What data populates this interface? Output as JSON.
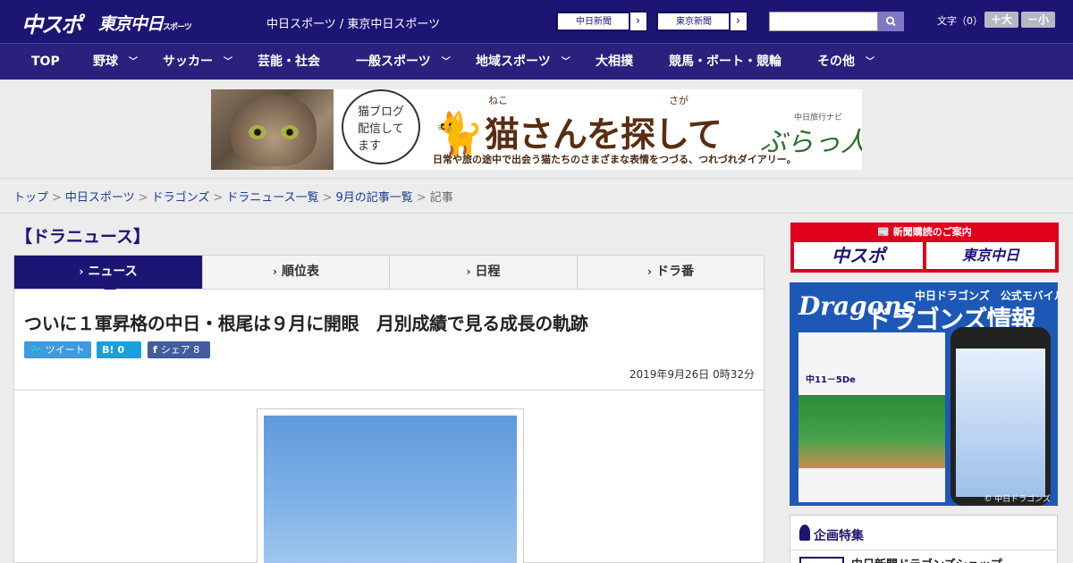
{
  "header": {
    "logo_chunichi": "中スポ",
    "logo_tokyo": "東京中日",
    "logo_tokyo_small": "スポーツ",
    "site_links": "中日スポーツ / 東京中日スポーツ",
    "ext_links": [
      "中日新聞",
      "東京新聞"
    ],
    "search_placeholder": "",
    "font_size_label": "文字（0）",
    "font_larger": "＋大",
    "font_smaller": "－小"
  },
  "nav": {
    "items": [
      {
        "label": "TOP",
        "has_menu": false
      },
      {
        "label": "野球",
        "has_menu": true
      },
      {
        "label": "サッカー",
        "has_menu": true
      },
      {
        "label": "芸能・社会",
        "has_menu": false
      },
      {
        "label": "一般スポーツ",
        "has_menu": true
      },
      {
        "label": "地域スポーツ",
        "has_menu": true
      },
      {
        "label": "大相撲",
        "has_menu": false
      },
      {
        "label": "競馬・ボート・競輪",
        "has_menu": false
      },
      {
        "label": "その他",
        "has_menu": true
      }
    ]
  },
  "banner": {
    "bubble_text": "猫ブログ配信してます",
    "ruby_neko": "ねこ",
    "ruby_saga": "さが",
    "title": "猫さんを探して",
    "subtitle": "日常や旅の途中で出会う猫たちのさまざまな表情をつづる、つれづれダイアリー。",
    "brand_small": "中日旅行ナビ",
    "brand": "ぶらっ人"
  },
  "breadcrumb": {
    "links": [
      "トップ",
      "中日スポーツ",
      "ドラゴンズ",
      "ドラニュース一覧",
      "9月の記事一覧"
    ],
    "current": "記事",
    "separator": ">"
  },
  "main": {
    "section_title": "【ドラニュース】",
    "tabs": [
      {
        "label": "ニュース",
        "active": true
      },
      {
        "label": "順位表",
        "active": false
      },
      {
        "label": "日程",
        "active": false
      },
      {
        "label": "ドラ番",
        "active": false
      }
    ],
    "headline": "ついに１軍昇格の中日・根尾は９月に開眼　月別成績で見る成長の軌跡",
    "share": {
      "tweet": "ツイート",
      "hatena_icon": "B!",
      "hatena_count": "0",
      "facebook_label": "シェア",
      "facebook_count": "8"
    },
    "date": "2019年9月26日 0時32分"
  },
  "sidebar": {
    "subscribe_title": "新聞購読のご案内",
    "subscribe_left": "中スポ",
    "subscribe_right": "東京中日",
    "dragons_logo": "Dragons",
    "dragons_top": "中日ドラゴンズ　公式モバイルサイト",
    "dragons_title": "ドラゴンズ情報",
    "dragons_score": "中11－5De",
    "dragons_copy": "© 中日ドラゴンズ",
    "feature_title": "企画特集",
    "feature_item": "中日新聞ドラゴンズショップ"
  },
  "colors": {
    "header_bg": "#1c1573",
    "nav_bg": "#2a217c",
    "accent_red": "#e0001b",
    "link": "#1a3c96"
  }
}
